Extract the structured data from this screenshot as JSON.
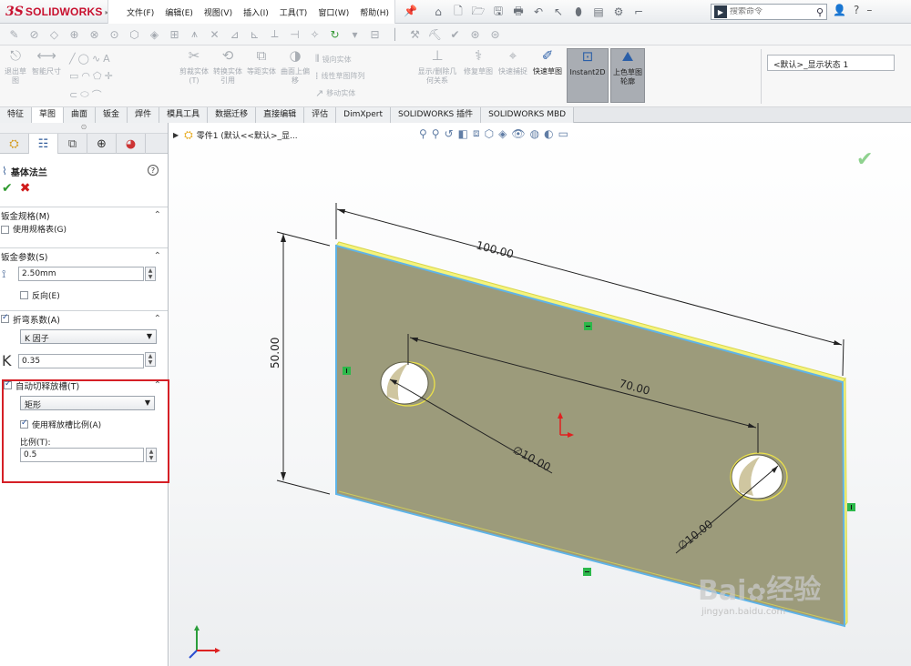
{
  "app": {
    "logo_ds": "3S",
    "logo_name": "SOLIDWORKS"
  },
  "menu": [
    "文件(F)",
    "编辑(E)",
    "视图(V)",
    "插入(I)",
    "工具(T)",
    "窗口(W)",
    "帮助(H)"
  ],
  "search": {
    "placeholder": "搜索命令"
  },
  "command_manager": {
    "sketch_exit": "退出草图",
    "smart_dim": "智能尺寸",
    "trim": "剪裁实体(T)",
    "convert": "转换实体引用",
    "offset": "等距实体",
    "offset_surface": "曲面上偏移",
    "mirror": "镜向实体",
    "linear_pattern": "线性草图阵列",
    "move": "移动实体",
    "display_relations": "显示/删除几何关系",
    "repair": "修复草图",
    "quick_snaps": "快速捕捉",
    "rapid_sketch": "快速草图",
    "instant2d": "Instant2D",
    "shaded_contours": "上色草图轮廓",
    "config": "<默认>_显示状态 1"
  },
  "tabs": [
    "特征",
    "草图",
    "曲面",
    "钣金",
    "焊件",
    "模具工具",
    "数据迁移",
    "直接编辑",
    "评估",
    "DimXpert",
    "SOLIDWORKS 插件",
    "SOLIDWORKS MBD"
  ],
  "active_tab": 1,
  "property_manager": {
    "title": "基体法兰",
    "sheet_gauge_header": "钣金规格(M)",
    "use_gauge_table": "使用规格表(G)",
    "sheet_params_header": "钣金参数(S)",
    "thickness": "2.50mm",
    "reverse": "反向(E)",
    "bend_allowance_header": "折弯系数(A)",
    "bend_type": "K 因子",
    "k_label": "K",
    "k_value": "0.35",
    "auto_relief_header": "自动切释放槽(T)",
    "relief_type": "矩形",
    "use_ratio": "使用释放槽比例(A)",
    "ratio_label": "比例(T):",
    "ratio_value": "0.5"
  },
  "viewport": {
    "breadcrumb": "零件1  (默认<<默认>_显...",
    "dims": {
      "width": "100.00",
      "height": "50.00",
      "hole_spacing": "70.00",
      "dia1": "∅10.00",
      "dia2": "∅10.00"
    },
    "colors": {
      "plate": "#9a9a78",
      "edge": "#5fb4e8",
      "top_edge": "#f3f07a",
      "dim": "#222222"
    },
    "watermark": {
      "brand": "Bai",
      "brand_cn": "经验",
      "url": "jingyan.baidu.com"
    }
  }
}
